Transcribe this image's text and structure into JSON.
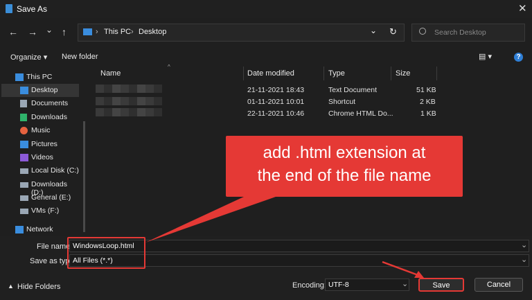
{
  "window": {
    "title": "Save As",
    "close_glyph": "✕"
  },
  "nav": {
    "back": "←",
    "forward": "→",
    "down": "⌄",
    "up": "↑"
  },
  "address": {
    "crumbs": [
      "This PC",
      "Desktop"
    ],
    "sep": "›",
    "dropdown": "⌄",
    "refresh": "↻"
  },
  "search": {
    "placeholder": "Search Desktop"
  },
  "toolbar": {
    "organize": "Organize ▾",
    "new_folder": "New folder",
    "view": "▤ ▾",
    "help": "?"
  },
  "sidebar": {
    "items": [
      {
        "label": "This PC",
        "icon": "monitor-icon",
        "color": "#3a8dde"
      },
      {
        "label": "Desktop",
        "icon": "desktop-icon",
        "color": "#3a8dde"
      },
      {
        "label": "Documents",
        "icon": "document-icon",
        "color": "#9aa7b5"
      },
      {
        "label": "Downloads",
        "icon": "download-icon",
        "color": "#2fb36b"
      },
      {
        "label": "Music",
        "icon": "music-icon",
        "color": "#e6623f"
      },
      {
        "label": "Pictures",
        "icon": "pictures-icon",
        "color": "#3a8dde"
      },
      {
        "label": "Videos",
        "icon": "videos-icon",
        "color": "#8c5ad8"
      },
      {
        "label": "Local Disk (C:)",
        "icon": "drive-icon",
        "color": "#9aa7b5"
      },
      {
        "label": "Downloads (D:)",
        "icon": "drive-icon",
        "color": "#9aa7b5"
      },
      {
        "label": "General (E:)",
        "icon": "drive-icon",
        "color": "#9aa7b5"
      },
      {
        "label": "VMs (F:)",
        "icon": "drive-icon",
        "color": "#9aa7b5"
      },
      {
        "label": "Network",
        "icon": "network-icon",
        "color": "#3a8dde"
      }
    ]
  },
  "columns": [
    "Name",
    "Date modified",
    "Type",
    "Size"
  ],
  "files": [
    {
      "date": "21-11-2021 18:43",
      "type": "Text Document",
      "size": "51 KB"
    },
    {
      "date": "01-11-2021 10:01",
      "type": "Shortcut",
      "size": "2 KB"
    },
    {
      "date": "22-11-2021 10:46",
      "type": "Chrome HTML Do...",
      "size": "1 KB"
    }
  ],
  "annotation": {
    "line1": "add .html extension at",
    "line2": "the end of the file name",
    "color": "#e53935"
  },
  "form": {
    "file_name_label": "File name:",
    "file_name_value": "WindowsLoop.html",
    "save_type_label": "Save as type:",
    "save_type_value": "All Files  (*.*)",
    "encoding_label": "Encoding:",
    "encoding_value": "UTF-8",
    "hide_folders": "Hide Folders",
    "save": "Save",
    "cancel": "Cancel"
  }
}
